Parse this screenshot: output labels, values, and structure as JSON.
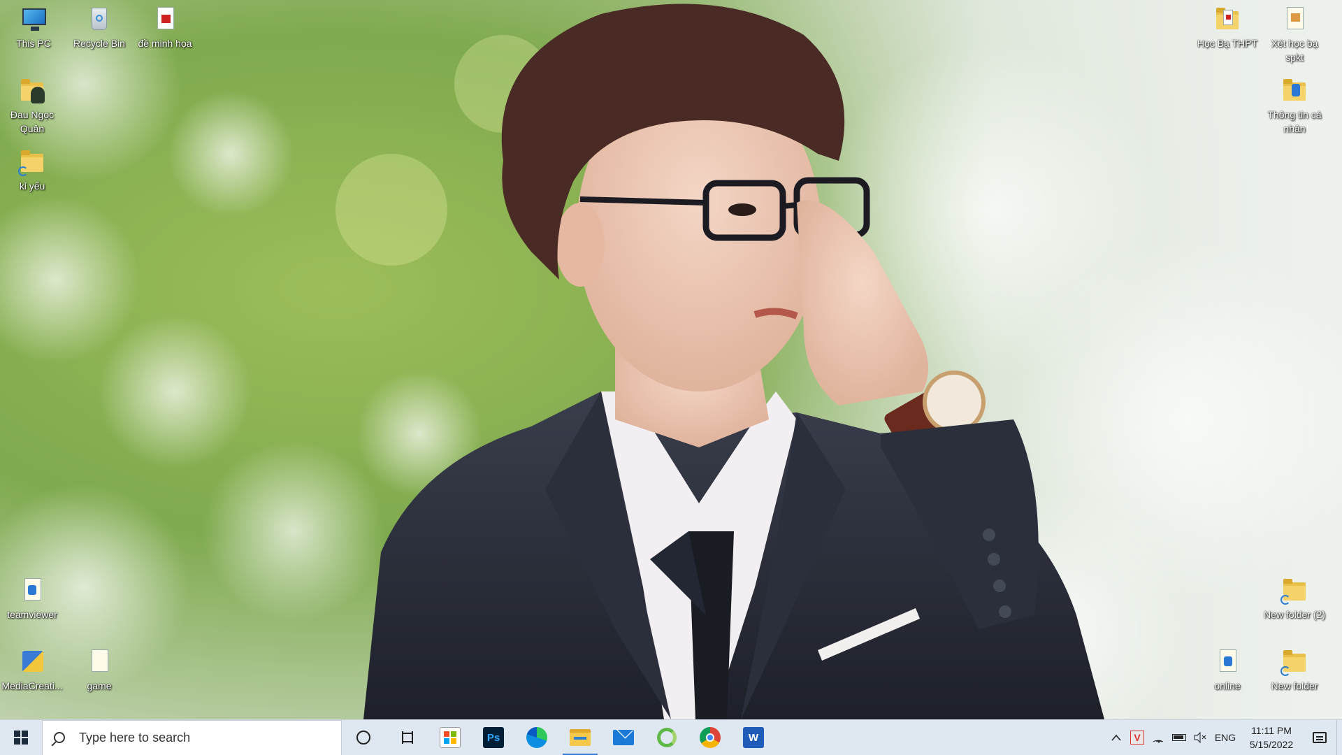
{
  "desktop": {
    "left_icons": [
      {
        "label": "This PC",
        "icon": "this-pc-icon"
      },
      {
        "label": "Recycle Bin",
        "icon": "recycle-bin-icon"
      },
      {
        "label": "đề minh họa",
        "icon": "pdf-document-icon"
      },
      {
        "label": "Đau Ngọc Quân",
        "icon": "user-folder-icon"
      },
      {
        "label": "kỉ yếu",
        "icon": "folder-shortcut-icon"
      },
      {
        "label": "teamviewer",
        "icon": "document-icon"
      },
      {
        "label": "MediaCreati...",
        "icon": "media-creation-tool-icon"
      },
      {
        "label": "game",
        "icon": "document-icon"
      }
    ],
    "right_icons": [
      {
        "label": "Học Bạ THPT",
        "icon": "pdf-folder-icon"
      },
      {
        "label": "Xét học bạ spkt",
        "icon": "document-icon"
      },
      {
        "label": "Thông tin cá nhân",
        "icon": "folder-icon"
      },
      {
        "label": "New folder (2)",
        "icon": "folder-shortcut-icon"
      },
      {
        "label": "online",
        "icon": "document-icon"
      },
      {
        "label": "New folder",
        "icon": "folder-shortcut-icon"
      }
    ]
  },
  "taskbar": {
    "search_placeholder": "Type here to search",
    "pinned_apps": [
      {
        "name": "cortana",
        "icon": "cortana-ring-icon"
      },
      {
        "name": "task-view",
        "icon": "task-view-icon"
      },
      {
        "name": "microsoft-store",
        "icon": "store-icon"
      },
      {
        "name": "photoshop",
        "icon": "photoshop-icon",
        "text": "Ps"
      },
      {
        "name": "edge",
        "icon": "edge-icon"
      },
      {
        "name": "file-explorer",
        "icon": "file-explorer-icon",
        "active": true
      },
      {
        "name": "mail",
        "icon": "mail-icon"
      },
      {
        "name": "app-green",
        "icon": "green-swirl-icon"
      },
      {
        "name": "chrome",
        "icon": "chrome-icon"
      },
      {
        "name": "word",
        "icon": "word-icon",
        "text": "W"
      }
    ],
    "tray": {
      "language": "ENG",
      "time": "11:11 PM",
      "date": "5/15/2022"
    }
  },
  "colors": {
    "taskbar_bg": "#dfe7f1",
    "accent": "#3d7bd6"
  }
}
